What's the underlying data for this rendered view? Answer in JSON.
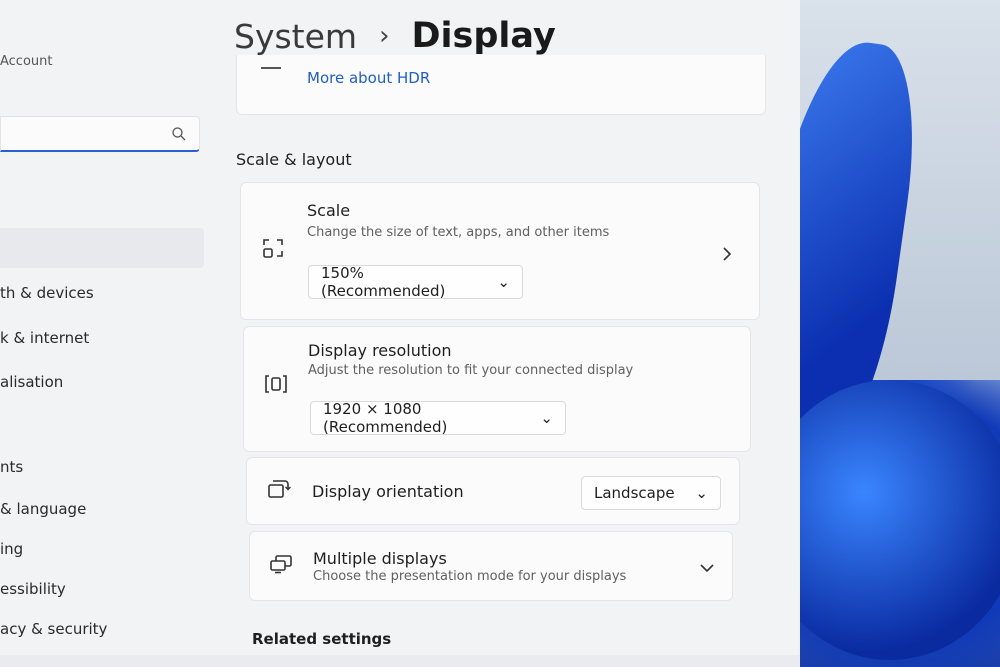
{
  "sidebar": {
    "account_label": "Account",
    "search_placeholder": "",
    "items": [
      {
        "label": "th & devices"
      },
      {
        "label": "k & internet"
      },
      {
        "label": "alisation"
      },
      {
        "label": "nts"
      },
      {
        "label": "& language"
      },
      {
        "label": "ing"
      },
      {
        "label": "essibility"
      },
      {
        "label": "acy & security"
      }
    ]
  },
  "header": {
    "parent": "System",
    "separator": "›",
    "current": "Display"
  },
  "hdr_card": {
    "link": "More about HDR"
  },
  "scale_layout": {
    "section_title": "Scale & layout",
    "scale": {
      "title": "Scale",
      "subtitle": "Change the size of text, apps, and other items",
      "value": "150% (Recommended)",
      "icon": "scale-icon"
    },
    "resolution": {
      "title": "Display resolution",
      "subtitle": "Adjust the resolution to fit your connected display",
      "value": "1920 × 1080 (Recommended)",
      "icon": "resolution-icon"
    },
    "orientation": {
      "title": "Display orientation",
      "value": "Landscape",
      "icon": "orientation-icon"
    },
    "multiple": {
      "title": "Multiple displays",
      "subtitle": "Choose the presentation mode for your displays",
      "icon": "multiple-displays-icon"
    }
  },
  "related": {
    "section_title": "Related settings"
  },
  "colors": {
    "accent": "#1f5fbf",
    "wallpaper": "#1a4bbf"
  }
}
